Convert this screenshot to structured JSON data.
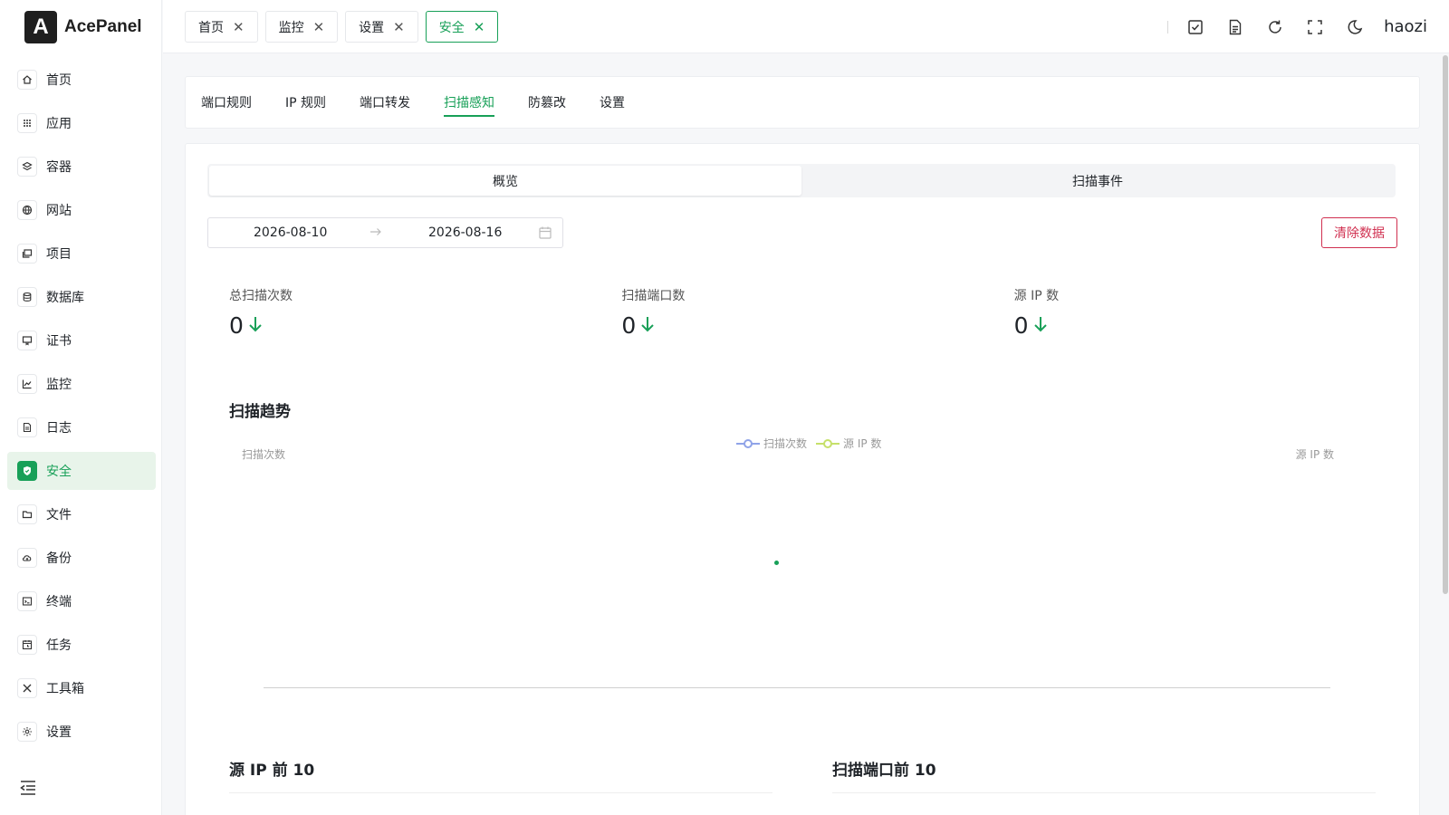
{
  "app": {
    "name": "AcePanel",
    "logo_letter": "A",
    "user": "haozi"
  },
  "sidebar": {
    "items": [
      {
        "label": "首页",
        "icon": "home-icon"
      },
      {
        "label": "应用",
        "icon": "grid-icon"
      },
      {
        "label": "容器",
        "icon": "layers-icon"
      },
      {
        "label": "网站",
        "icon": "globe-icon"
      },
      {
        "label": "项目",
        "icon": "folder-stack-icon"
      },
      {
        "label": "数据库",
        "icon": "database-icon"
      },
      {
        "label": "证书",
        "icon": "certificate-icon"
      },
      {
        "label": "监控",
        "icon": "chart-icon"
      },
      {
        "label": "日志",
        "icon": "file-icon"
      },
      {
        "label": "安全",
        "icon": "shield-icon",
        "active": true
      },
      {
        "label": "文件",
        "icon": "folder-icon"
      },
      {
        "label": "备份",
        "icon": "cloud-icon"
      },
      {
        "label": "终端",
        "icon": "terminal-icon"
      },
      {
        "label": "任务",
        "icon": "calendar-task-icon"
      },
      {
        "label": "工具箱",
        "icon": "tools-icon"
      },
      {
        "label": "设置",
        "icon": "gear-icon"
      }
    ]
  },
  "header": {
    "tabs": [
      {
        "label": "首页"
      },
      {
        "label": "监控"
      },
      {
        "label": "设置"
      },
      {
        "label": "安全",
        "active": true
      }
    ]
  },
  "security": {
    "subnav": [
      "端口规则",
      "IP 规则",
      "端口转发",
      "扫描感知",
      "防篡改",
      "设置"
    ],
    "subnav_active": "扫描感知",
    "segments": [
      "概览",
      "扫描事件"
    ],
    "date_start": "2026-08-10",
    "date_end": "2026-08-16",
    "clear_button": "清除数据",
    "stats": [
      {
        "label": "总扫描次数",
        "value": "0"
      },
      {
        "label": "扫描端口数",
        "value": "0"
      },
      {
        "label": "源 IP 数",
        "value": "0"
      }
    ],
    "trend_title": "扫描趋势",
    "top_ip_title": "源 IP 前 10",
    "top_port_title": "扫描端口前 10"
  },
  "chart_data": {
    "type": "line",
    "title": "扫描趋势",
    "ylabel": "扫描次数",
    "ylabel_right": "源 IP 数",
    "series": [
      {
        "name": "扫描次数",
        "values": []
      },
      {
        "name": "源 IP 数",
        "values": []
      }
    ],
    "legend": "top-center"
  },
  "colors": {
    "accent": "#18a058",
    "danger": "#d03050",
    "series_scan": "#8fa3e8",
    "series_ip": "#c6e06a"
  }
}
